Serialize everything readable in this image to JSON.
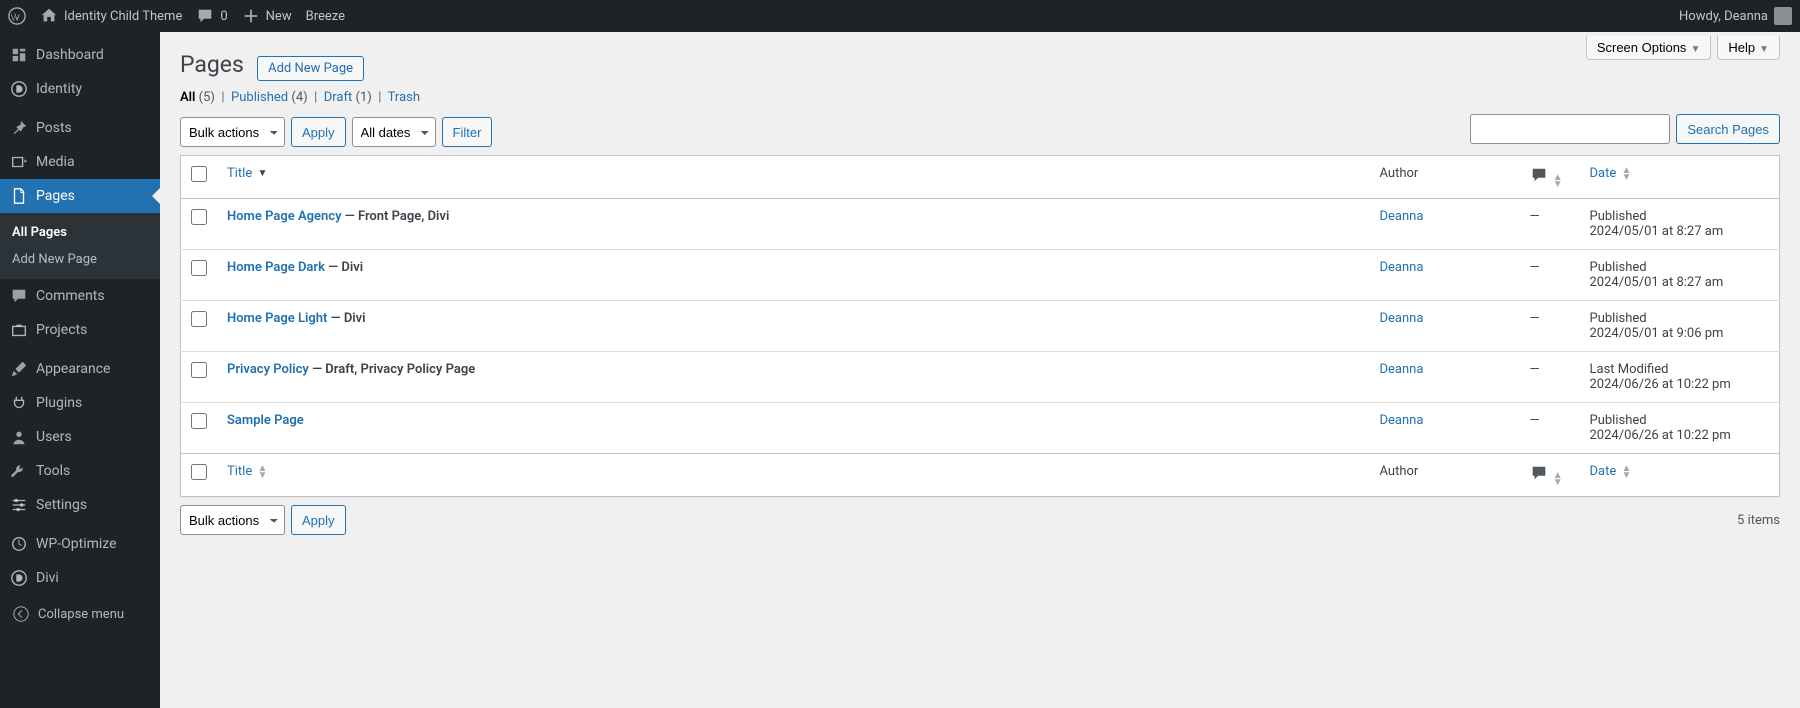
{
  "adminbar": {
    "site_title": "Identity Child Theme",
    "comments_count": "0",
    "new_label": "New",
    "breeze_label": "Breeze",
    "howdy": "Howdy, Deanna"
  },
  "sidebar": {
    "items": [
      {
        "label": "Dashboard",
        "icon": "dashboard"
      },
      {
        "label": "Identity",
        "icon": "circle-d"
      },
      {
        "label": "Posts",
        "icon": "pin"
      },
      {
        "label": "Media",
        "icon": "media"
      },
      {
        "label": "Pages",
        "icon": "page",
        "current": true
      },
      {
        "label": "Comments",
        "icon": "comment"
      },
      {
        "label": "Projects",
        "icon": "portfolio"
      },
      {
        "label": "Appearance",
        "icon": "brush"
      },
      {
        "label": "Plugins",
        "icon": "plug"
      },
      {
        "label": "Users",
        "icon": "user"
      },
      {
        "label": "Tools",
        "icon": "wrench"
      },
      {
        "label": "Settings",
        "icon": "sliders"
      },
      {
        "label": "WP-Optimize",
        "icon": "optimize"
      },
      {
        "label": "Divi",
        "icon": "circle-d"
      }
    ],
    "submenu": {
      "parent": "Pages",
      "items": [
        {
          "label": "All Pages",
          "current": true
        },
        {
          "label": "Add New Page"
        }
      ]
    },
    "collapse_label": "Collapse menu"
  },
  "screen_tabs": {
    "screen_options": "Screen Options",
    "help": "Help"
  },
  "header": {
    "title": "Pages",
    "add_new": "Add New Page"
  },
  "views": {
    "all": {
      "label": "All",
      "count": "(5)"
    },
    "published": {
      "label": "Published",
      "count": "(4)"
    },
    "draft": {
      "label": "Draft",
      "count": "(1)"
    },
    "trash": {
      "label": "Trash"
    }
  },
  "filters": {
    "bulk_actions": "Bulk actions",
    "apply": "Apply",
    "dates": "All dates",
    "filter": "Filter"
  },
  "search": {
    "button": "Search Pages",
    "value": ""
  },
  "pagination": {
    "count": "5 items"
  },
  "columns": {
    "title": "Title",
    "author": "Author",
    "date": "Date"
  },
  "rows": [
    {
      "title": "Home Page Agency",
      "state": "— Front Page, Divi",
      "author": "Deanna",
      "comments": "—",
      "date_status": "Published",
      "date_value": "2024/05/01 at 8:27 am"
    },
    {
      "title": "Home Page Dark",
      "state": "— Divi",
      "author": "Deanna",
      "comments": "—",
      "date_status": "Published",
      "date_value": "2024/05/01 at 8:27 am"
    },
    {
      "title": "Home Page Light",
      "state": "— Divi",
      "author": "Deanna",
      "comments": "—",
      "date_status": "Published",
      "date_value": "2024/05/01 at 9:06 pm"
    },
    {
      "title": "Privacy Policy",
      "state": "— Draft, Privacy Policy Page",
      "author": "Deanna",
      "comments": "—",
      "date_status": "Last Modified",
      "date_value": "2024/06/26 at 10:22 pm"
    },
    {
      "title": "Sample Page",
      "state": "",
      "author": "Deanna",
      "comments": "—",
      "date_status": "Published",
      "date_value": "2024/06/26 at 10:22 pm"
    }
  ]
}
